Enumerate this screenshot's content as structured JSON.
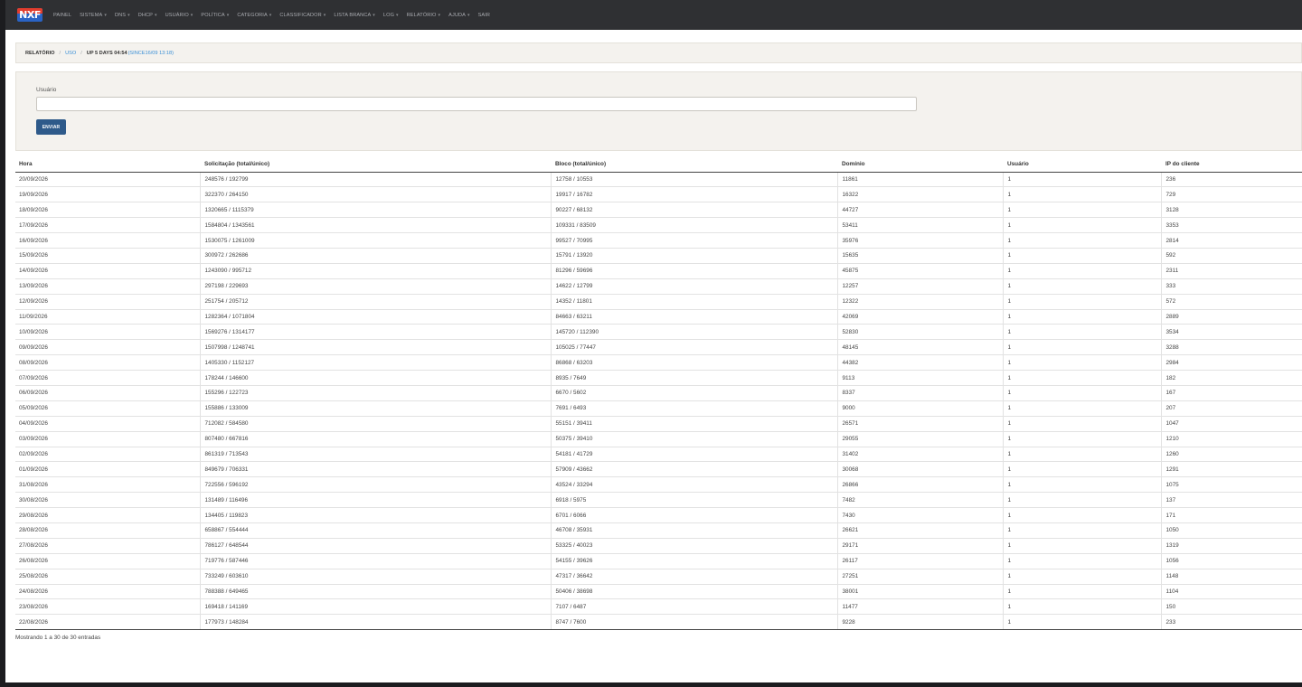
{
  "nav": {
    "logo": "NXF",
    "items": [
      {
        "label": "PAINEL",
        "dropdown": false
      },
      {
        "label": "SISTEMA",
        "dropdown": true
      },
      {
        "label": "DNS",
        "dropdown": true
      },
      {
        "label": "DHCP",
        "dropdown": true
      },
      {
        "label": "USUÁRIO",
        "dropdown": true
      },
      {
        "label": "POLÍTICA",
        "dropdown": true
      },
      {
        "label": "CATEGORIA",
        "dropdown": true
      },
      {
        "label": "CLASSIFICADOR",
        "dropdown": true
      },
      {
        "label": "LISTA BRANCA",
        "dropdown": true
      },
      {
        "label": "LOG",
        "dropdown": true
      },
      {
        "label": "RELATÓRIO",
        "dropdown": true
      },
      {
        "label": "AJUDA",
        "dropdown": true
      },
      {
        "label": "SAIR",
        "dropdown": false
      }
    ]
  },
  "breadcrumb": {
    "relatorio": "RELATÓRIO",
    "sep": "/",
    "uso": "USO",
    "uptime": "UP 5 DAYS 04:54",
    "since": "(SINCE16/09 13:18)"
  },
  "form": {
    "label": "Usuário",
    "value": "",
    "submit": "ENVIAR"
  },
  "table": {
    "headers": [
      "Hora",
      "Solicitação (total/único)",
      "Bloco (total/único)",
      "Domínio",
      "Usuário",
      "IP do cliente"
    ],
    "rows": [
      [
        "20/09/2026",
        "248576 / 192799",
        "12758 / 10553",
        "11861",
        "1",
        "236"
      ],
      [
        "19/09/2026",
        "322370 / 264150",
        "19917 / 16782",
        "16322",
        "1",
        "729"
      ],
      [
        "18/09/2026",
        "1320665 / 1115379",
        "90227 / 68132",
        "44727",
        "1",
        "3128"
      ],
      [
        "17/09/2026",
        "1584804 / 1343561",
        "109331 / 83509",
        "53411",
        "1",
        "3353"
      ],
      [
        "16/09/2026",
        "1530075 / 1261009",
        "99527 / 70995",
        "35976",
        "1",
        "2814"
      ],
      [
        "15/09/2026",
        "300972 / 262686",
        "15791 / 13920",
        "15635",
        "1",
        "592"
      ],
      [
        "14/09/2026",
        "1243090 / 995712",
        "81296 / 59696",
        "45875",
        "1",
        "2311"
      ],
      [
        "13/09/2026",
        "297198 / 229693",
        "14622 / 12799",
        "12257",
        "1",
        "333"
      ],
      [
        "12/09/2026",
        "251754 / 205712",
        "14352 / 11801",
        "12322",
        "1",
        "572"
      ],
      [
        "11/09/2026",
        "1282364 / 1071804",
        "84663 / 63211",
        "42069",
        "1",
        "2889"
      ],
      [
        "10/09/2026",
        "1569276 / 1314177",
        "145720 / 112390",
        "52830",
        "1",
        "3534"
      ],
      [
        "09/09/2026",
        "1507998 / 1248741",
        "105025 / 77447",
        "48145",
        "1",
        "3288"
      ],
      [
        "08/09/2026",
        "1405330 / 1152127",
        "86868 / 63203",
        "44382",
        "1",
        "2984"
      ],
      [
        "07/09/2026",
        "178244 / 146600",
        "8935 / 7649",
        "9113",
        "1",
        "182"
      ],
      [
        "06/09/2026",
        "155296 / 122723",
        "6670 / 5602",
        "8337",
        "1",
        "167"
      ],
      [
        "05/09/2026",
        "155886 / 133009",
        "7691 / 6493",
        "9000",
        "1",
        "207"
      ],
      [
        "04/09/2026",
        "712082 / 584580",
        "55151 / 39411",
        "26571",
        "1",
        "1047"
      ],
      [
        "03/09/2026",
        "807480 / 667816",
        "50375 / 39410",
        "29055",
        "1",
        "1210"
      ],
      [
        "02/09/2026",
        "861319 / 713543",
        "54181 / 41729",
        "31402",
        "1",
        "1260"
      ],
      [
        "01/09/2026",
        "849679 / 706331",
        "57909 / 43662",
        "30068",
        "1",
        "1291"
      ],
      [
        "31/08/2026",
        "722556 / 596192",
        "43524 / 33294",
        "26866",
        "1",
        "1075"
      ],
      [
        "30/08/2026",
        "131489 / 116496",
        "6918 / 5975",
        "7482",
        "1",
        "137"
      ],
      [
        "29/08/2026",
        "134405 / 119823",
        "6701 / 6066",
        "7430",
        "1",
        "171"
      ],
      [
        "28/08/2026",
        "658867 / 554444",
        "46708 / 35931",
        "26621",
        "1",
        "1050"
      ],
      [
        "27/08/2026",
        "786127 / 648544",
        "53325 / 40023",
        "29171",
        "1",
        "1319"
      ],
      [
        "26/08/2026",
        "719776 / 587446",
        "54155 / 39626",
        "26117",
        "1",
        "1056"
      ],
      [
        "25/08/2026",
        "733249 / 603610",
        "47317 / 36642",
        "27251",
        "1",
        "1148"
      ],
      [
        "24/08/2026",
        "788388 / 649465",
        "50406 / 38698",
        "38001",
        "1",
        "1104"
      ],
      [
        "23/08/2026",
        "169418 / 141169",
        "7107 / 6487",
        "11477",
        "1",
        "150"
      ],
      [
        "22/08/2026",
        "177973 / 148284",
        "8747 / 7600",
        "9228",
        "1",
        "233"
      ]
    ]
  },
  "footer": {
    "info": "Mostrando 1 a 30 de 30 entradas"
  },
  "colors": {
    "navbar": "#2f3033",
    "panel": "#f4f2ee",
    "button": "#2e5a8a",
    "link": "#3a8fd6"
  }
}
